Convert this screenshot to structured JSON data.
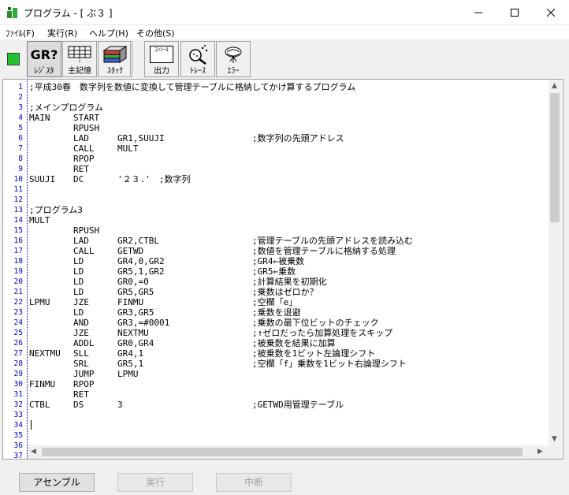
{
  "window": {
    "title": "プログラム - [ ぶ３ ]"
  },
  "menu": [
    "ﾌｧｲﾙ(F)",
    "実行(R)",
    "ヘルプ(H)",
    "その他(S)"
  ],
  "toolbar": {
    "buttons": [
      {
        "label": "ﾚｼﾞｽﾀ",
        "icon_text": "GR?"
      },
      {
        "label": "主記憶"
      },
      {
        "label": "ｽﾀｯｸ"
      },
      {
        "label": "出力",
        "icon_text": "ｺﾝｿｰﾙ"
      },
      {
        "label": "ﾄﾚｰｽ"
      },
      {
        "label": "ｴﾗｰ"
      }
    ],
    "indicator_color": "#22c22e"
  },
  "editor": {
    "line_numbers": [
      "1",
      "2",
      "3",
      "4",
      "5",
      "6",
      "7",
      "8",
      "9",
      "10",
      "11",
      "12",
      "13",
      "14",
      "15",
      "16",
      "17",
      "18",
      "19",
      "20",
      "21",
      "22",
      "23",
      "24",
      "25",
      "26",
      "27",
      "28",
      "29",
      "30",
      "31",
      "32",
      "33",
      "34",
      "35",
      "36",
      "37"
    ],
    "lines": [
      {
        "label": ";平成30春　数字列を数値に変換して管理テーブルに格納してかけ算するプログラム"
      },
      {},
      {
        "label": ";メインプログラム"
      },
      {
        "label": "MAIN",
        "op": "START"
      },
      {
        "op": "RPUSH"
      },
      {
        "op": "LAD",
        "opr": "GR1,SUUJI",
        "cmt": ";数字列の先頭アドレス"
      },
      {
        "op": "CALL",
        "opr": "MULT"
      },
      {
        "op": "RPOP"
      },
      {
        "op": "RET"
      },
      {
        "label": "SUUJI",
        "op": "DC",
        "opr": "'２３.'　;数字列"
      },
      {},
      {},
      {
        "label": ";プログラム3"
      },
      {
        "label": "MULT"
      },
      {
        "op": "RPUSH"
      },
      {
        "op": "LAD",
        "opr": "GR2,CTBL",
        "cmt": ";管理テーブルの先頭アドレスを読み込む"
      },
      {
        "op": "CALL",
        "opr": "GETWD",
        "cmt": ";数値を管理テーブルに格納する処理"
      },
      {
        "op": "LD",
        "opr": "GR4,0,GR2",
        "cmt": ";GR4←被乗数"
      },
      {
        "op": "LD",
        "opr": "GR5,1,GR2",
        "cmt": ";GR5←乗数"
      },
      {
        "op": "LD",
        "opr": "GR0,=0",
        "cmt": ";計算結果を初期化"
      },
      {
        "op": "LD",
        "opr": "GR5,GR5",
        "cmt": ";乗数はゼロか？"
      },
      {
        "label": "LPMU",
        "op": "JZE",
        "opr": "FINMU",
        "cmt": ";空欄「e」"
      },
      {
        "op": "LD",
        "opr": "GR3,GR5",
        "cmt": ";乗数を退避"
      },
      {
        "op": "AND",
        "opr": "GR3,=#0001",
        "cmt": ";乗数の最下位ビットのチェック"
      },
      {
        "op": "JZE",
        "opr": "NEXTMU",
        "cmt": ";↑ゼロだったら加算処理をスキップ"
      },
      {
        "op": "ADDL",
        "opr": "GR0,GR4",
        "cmt": ";被乗数を結果に加算"
      },
      {
        "label": "NEXTMU",
        "op": "SLL",
        "opr": "GR4,1",
        "cmt": ";被乗数を1ビット左論理シフト"
      },
      {
        "op": "SRL",
        "opr": "GR5,1",
        "cmt": ";空欄「f」乗数を1ビット右論理シフト"
      },
      {
        "op": "JUMP",
        "opr": "LPMU"
      },
      {
        "label": "FINMU",
        "op": "RPOP"
      },
      {
        "op": "RET"
      },
      {
        "label": "CTBL",
        "op": "DS",
        "opr": "3",
        "cmt": ";GETWD用管理テーブル"
      },
      {},
      {},
      {},
      {},
      {}
    ]
  },
  "buttons": {
    "assemble": "アセンブル",
    "run": "実行",
    "abort": "中断"
  }
}
